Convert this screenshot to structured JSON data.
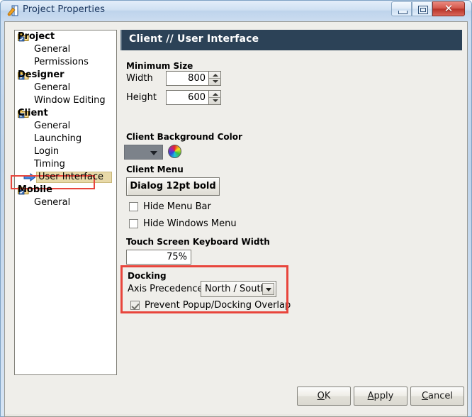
{
  "window": {
    "title": "Project Properties",
    "icon": "app-icon",
    "controls": {
      "minimize": "minimize-icon",
      "maximize": "maximize-icon",
      "close_label": "✕"
    }
  },
  "tree": {
    "items": [
      {
        "label": "Project",
        "type": "node",
        "icon": "folder-icon",
        "selected": false
      },
      {
        "label": "General",
        "type": "leaf",
        "icon": "",
        "selected": false
      },
      {
        "label": "Permissions",
        "type": "leaf",
        "icon": "",
        "selected": false
      },
      {
        "label": "Designer",
        "type": "node",
        "icon": "folder-icon",
        "selected": false
      },
      {
        "label": "General",
        "type": "leaf",
        "icon": "",
        "selected": false
      },
      {
        "label": "Window Editing",
        "type": "leaf",
        "icon": "",
        "selected": false
      },
      {
        "label": "Client",
        "type": "node",
        "icon": "folder-icon",
        "selected": false
      },
      {
        "label": "General",
        "type": "leaf",
        "icon": "",
        "selected": false
      },
      {
        "label": "Launching",
        "type": "leaf",
        "icon": "",
        "selected": false
      },
      {
        "label": "Login",
        "type": "leaf",
        "icon": "",
        "selected": false
      },
      {
        "label": "Timing",
        "type": "leaf",
        "icon": "",
        "selected": false
      },
      {
        "label": "User Interface",
        "type": "leaf",
        "icon": "blue-arrow-icon",
        "selected": true
      },
      {
        "label": "Mobile",
        "type": "node",
        "icon": "folder-icon",
        "selected": false
      },
      {
        "label": "General",
        "type": "leaf",
        "icon": "",
        "selected": false
      }
    ]
  },
  "panel": {
    "header": "Client // User Interface",
    "minimum_size": {
      "section_label": "Minimum Size",
      "width_label": "Width",
      "width_value": "800",
      "height_label": "Height",
      "height_value": "600"
    },
    "background_color": {
      "section_label": "Client Background Color",
      "swatch_color": "#7c828a",
      "picker_icon": "color-wheel-icon"
    },
    "client_menu": {
      "section_label": "Client Menu",
      "font_button": "Dialog 12pt bold",
      "hide_menu_bar": "Hide Menu Bar",
      "hide_menu_bar_checked": false,
      "hide_windows_menu": "Hide Windows Menu",
      "hide_windows_menu_checked": false
    },
    "touch_keyboard": {
      "section_label": "Touch Screen Keyboard Width",
      "value": "75%"
    },
    "docking": {
      "section_label": "Docking",
      "axis_label": "Axis Precedence",
      "axis_value": "North / South",
      "prevent_overlap_label": "Prevent Popup/Docking Overlap",
      "prevent_overlap_checked": true,
      "highlight_color": "#e8453c"
    }
  },
  "buttons": {
    "ok": "OK",
    "ok_mnemonic": "O",
    "ok_rest": "K",
    "apply": "Apply",
    "apply_mnemonic": "A",
    "apply_rest": "pply",
    "cancel": "Cancel",
    "cancel_mnemonic": "C",
    "cancel_rest": "ancel"
  }
}
